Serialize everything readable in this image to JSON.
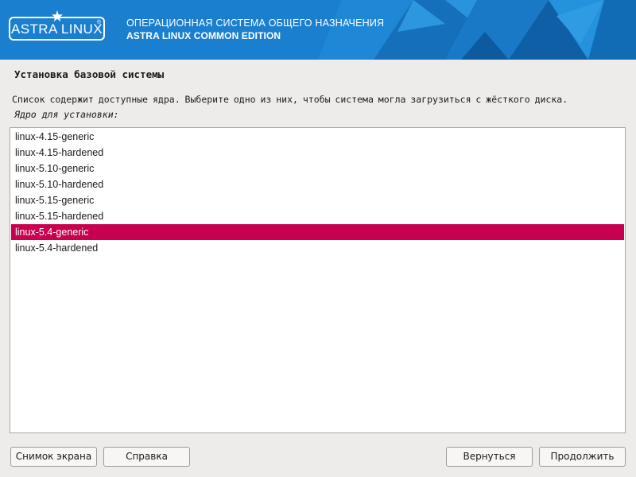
{
  "banner": {
    "logo": "ASTRA LINUX",
    "line1": "ОПЕРАЦИОННАЯ СИСТЕМА ОБЩЕГО НАЗНАЧЕНИЯ",
    "line2": "ASTRA LINUX COMMON EDITION"
  },
  "page": {
    "title": "Установка базовой системы",
    "description": "Список содержит доступные ядра. Выберите одно из них, чтобы система могла загрузиться с жёсткого диска.",
    "field_label": "Ядро для установки:"
  },
  "kernel_list": {
    "items": [
      {
        "label": "linux-4.15-generic",
        "selected": false
      },
      {
        "label": "linux-4.15-hardened",
        "selected": false
      },
      {
        "label": "linux-5.10-generic",
        "selected": false
      },
      {
        "label": "linux-5.10-hardened",
        "selected": false
      },
      {
        "label": "linux-5.15-generic",
        "selected": false
      },
      {
        "label": "linux-5.15-hardened",
        "selected": false
      },
      {
        "label": "linux-5.4-generic",
        "selected": true
      },
      {
        "label": "linux-5.4-hardened",
        "selected": false
      }
    ],
    "selected_value": "linux-5.4-generic"
  },
  "buttons": {
    "screenshot": "Снимок экрана",
    "help": "Справка",
    "back": "Вернуться",
    "continue": "Продолжить"
  },
  "colors": {
    "banner_blue": "#1a7fcf",
    "selection": "#c8004f",
    "background": "#edeceb"
  }
}
